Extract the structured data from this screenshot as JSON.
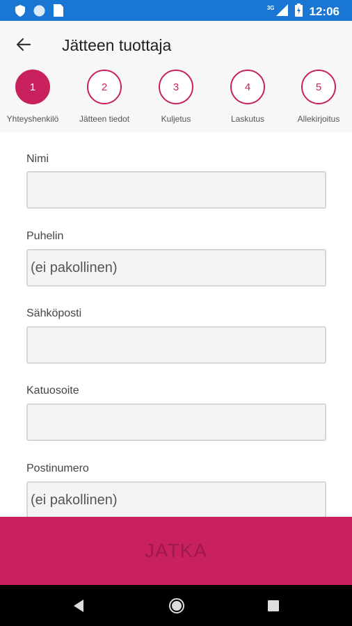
{
  "statusbar": {
    "time": "12:06",
    "network": "3G",
    "icons": [
      "shield-icon",
      "circle-icon",
      "sim-icon",
      "signal-icon",
      "battery-icon"
    ]
  },
  "header": {
    "title": "Jätteen tuottaja",
    "back_icon": "arrow-left-icon"
  },
  "steps": [
    {
      "number": "1",
      "label": "Yhteyshenkilö",
      "active": true
    },
    {
      "number": "2",
      "label": "Jätteen tiedot",
      "active": false
    },
    {
      "number": "3",
      "label": "Kuljetus",
      "active": false
    },
    {
      "number": "4",
      "label": "Laskutus",
      "active": false
    },
    {
      "number": "5",
      "label": "Allekirjoitus",
      "active": false
    }
  ],
  "form": {
    "fields": [
      {
        "label": "Nimi",
        "value": "",
        "placeholder": ""
      },
      {
        "label": "Puhelin",
        "value": "",
        "placeholder": "(ei pakollinen)"
      },
      {
        "label": "Sähköposti",
        "value": "",
        "placeholder": ""
      },
      {
        "label": "Katuosoite",
        "value": "",
        "placeholder": ""
      },
      {
        "label": "Postinumero",
        "value": "",
        "placeholder": "(ei pakollinen)"
      }
    ]
  },
  "continue_button": {
    "label": "JATKA"
  },
  "colors": {
    "accent": "#c8215e",
    "statusbar": "#1976d2",
    "navbar": "#000000"
  }
}
